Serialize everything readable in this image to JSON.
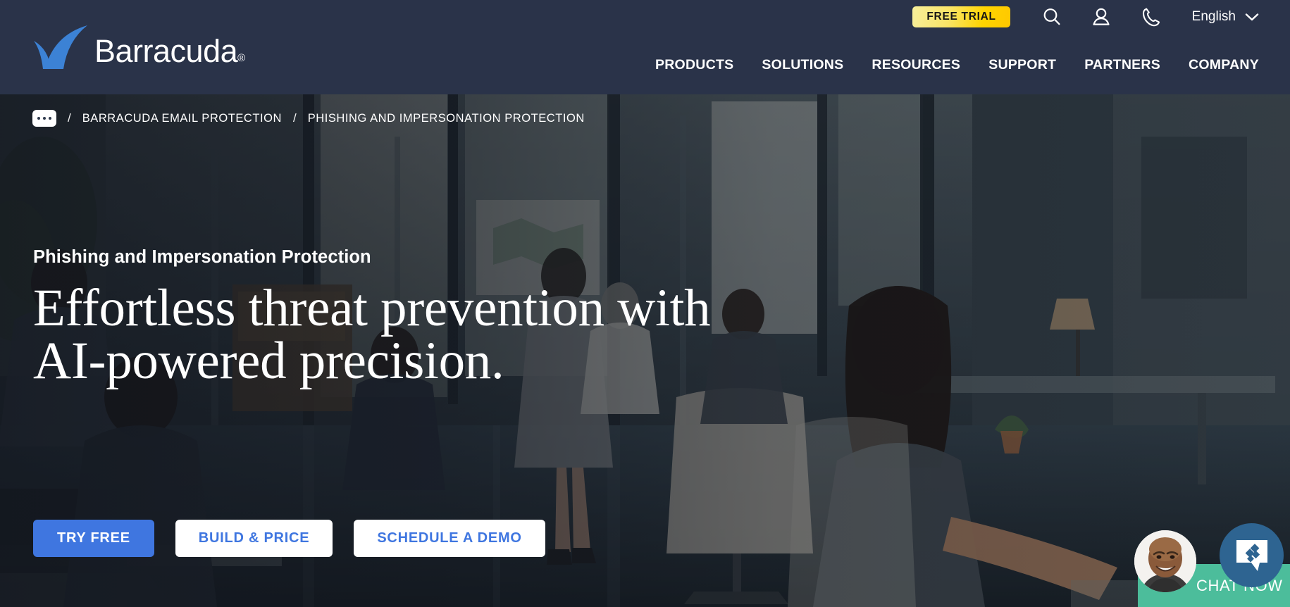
{
  "brand": {
    "name": "Barracuda",
    "registered_mark": "®",
    "logo_blue": "#3c82d5",
    "nav_background": "#2a3349"
  },
  "topnav": {
    "free_trial_label": "FREE TRIAL",
    "free_trial_gradient_from": "#f7ef9b",
    "free_trial_gradient_to": "#ffc800",
    "icons": [
      {
        "name": "search-icon",
        "title": "Search"
      },
      {
        "name": "user-account-icon",
        "title": "Account"
      },
      {
        "name": "phone-icon",
        "title": "Contact"
      }
    ],
    "language": {
      "selected": "English",
      "chevron": "chevron-down-icon"
    },
    "menu": [
      {
        "label": "PRODUCTS"
      },
      {
        "label": "SOLUTIONS"
      },
      {
        "label": "RESOURCES"
      },
      {
        "label": "SUPPORT"
      },
      {
        "label": "PARTNERS"
      },
      {
        "label": "COMPANY"
      }
    ]
  },
  "breadcrumb": {
    "overflow_icon": "ellipsis-icon",
    "separator": "/",
    "items": [
      {
        "label": "BARRACUDA EMAIL PROTECTION",
        "current": false
      },
      {
        "label": "PHISHING AND IMPERSONATION PROTECTION",
        "current": true
      }
    ]
  },
  "hero": {
    "eyebrow": "Phishing and Impersonation Protection",
    "headline": "Effortless threat prevention with\nAI-powered precision.",
    "buttons": [
      {
        "label": "TRY FREE",
        "style": "primary",
        "color": "#3f76e0"
      },
      {
        "label": "BUILD & PRICE",
        "style": "ghost",
        "color": "#ffffff"
      },
      {
        "label": "SCHEDULE A DEMO",
        "style": "ghost",
        "color": "#ffffff"
      }
    ],
    "background_description": "Dark-toned office interior with colleagues working at desks and a glass-walled meeting area"
  },
  "chat": {
    "label": "CHAT NOW",
    "bar_color": "#4cbd9b",
    "fab_color": "#2e6491",
    "fab_icon": "chat-bubble-icon",
    "avatar_icon": "agent-avatar"
  }
}
